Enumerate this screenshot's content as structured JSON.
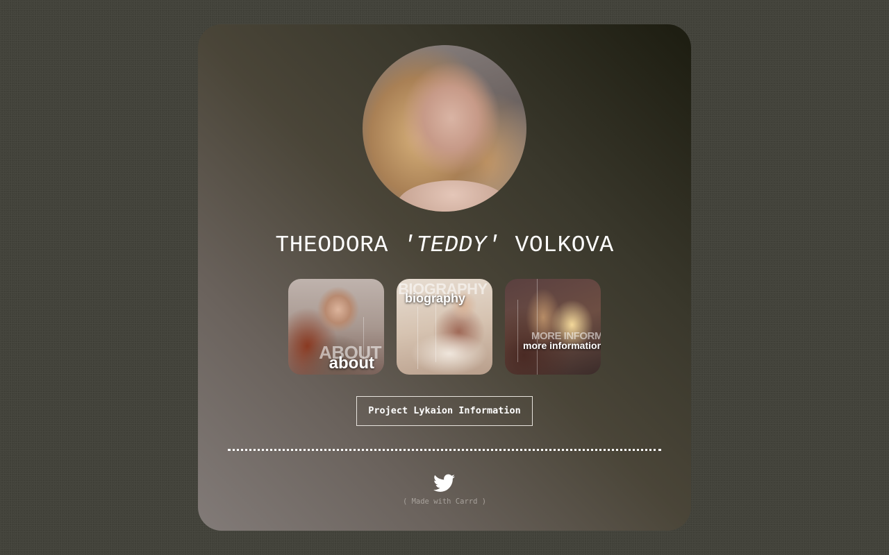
{
  "profile": {
    "avatar_alt": "profile photo",
    "name_first": "THEODORA",
    "name_nick": "'TEDDY'",
    "name_last": "VOLKOVA"
  },
  "tiles": [
    {
      "ghost": "ABOUT",
      "label": "about"
    },
    {
      "ghost": "BIOGRAPHY",
      "label": "biography"
    },
    {
      "ghost": "MORE INFORMATION",
      "label": "more information"
    }
  ],
  "button": {
    "label": "Project Lykaion Information"
  },
  "footer": {
    "social_icon": "twitter-icon",
    "credit": "( Made with Carrd )"
  },
  "colors": {
    "page_background": "#42423a",
    "text": "#ffffff",
    "credit_text": "#a8a29c"
  }
}
